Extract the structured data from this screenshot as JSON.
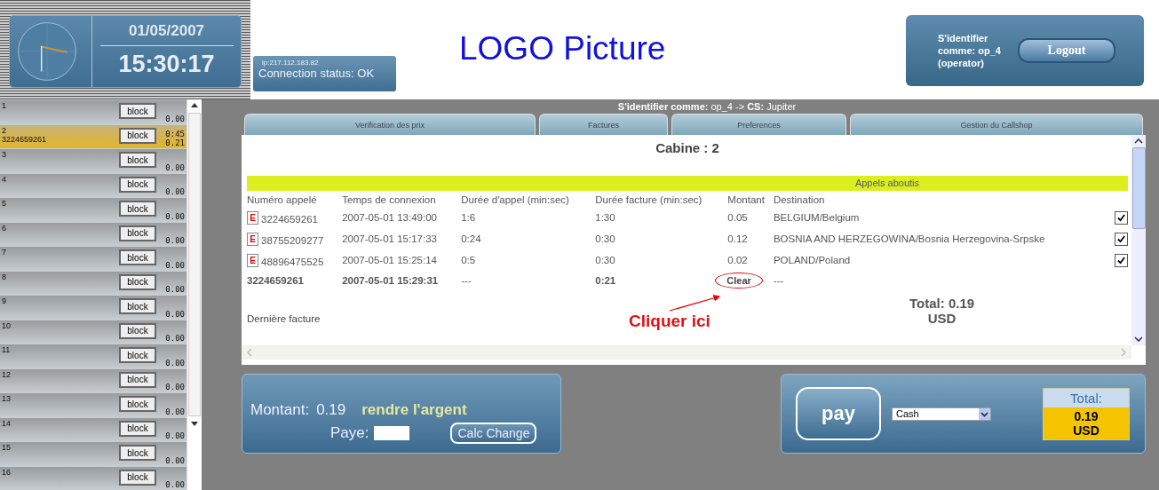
{
  "clock": {
    "date": "01/05/2007",
    "time": "15:30:17"
  },
  "connection": {
    "ip": "ip:217.112.183.82",
    "status": "Connection status: OK"
  },
  "logo": "LOGO Picture",
  "login": {
    "user": "S'identifier comme: op_4 (operator)",
    "button": "Logout"
  },
  "cabins": [
    {
      "number": "1",
      "amount": "0.00",
      "selected": false,
      "button": "block"
    },
    {
      "number": "2",
      "phone": "3224659261",
      "duration": "0:45",
      "amount": "0.21",
      "selected": true,
      "button": "block"
    },
    {
      "number": "3",
      "amount": "0.00",
      "selected": false,
      "button": "block"
    },
    {
      "number": "4",
      "amount": "0.00",
      "selected": false,
      "button": "block"
    },
    {
      "number": "5",
      "amount": "0.00",
      "selected": false,
      "button": "block"
    },
    {
      "number": "6",
      "amount": "0.00",
      "selected": false,
      "button": "block"
    },
    {
      "number": "7",
      "amount": "0.00",
      "selected": false,
      "button": "block"
    },
    {
      "number": "8",
      "amount": "0.00",
      "selected": false,
      "button": "block"
    },
    {
      "number": "9",
      "amount": "0.00",
      "selected": false,
      "button": "block"
    },
    {
      "number": "10",
      "amount": "0.00",
      "selected": false,
      "button": "block"
    },
    {
      "number": "11",
      "amount": "0.00",
      "selected": false,
      "button": "block"
    },
    {
      "number": "12",
      "amount": "0.00",
      "selected": false,
      "button": "block"
    },
    {
      "number": "13",
      "amount": "0.00",
      "selected": false,
      "button": "block"
    },
    {
      "number": "14",
      "amount": "0.00",
      "selected": false,
      "button": "block"
    },
    {
      "number": "15",
      "amount": "0.00",
      "selected": false,
      "button": "block"
    },
    {
      "number": "16",
      "amount": "0.00",
      "selected": false,
      "button": "block"
    }
  ],
  "session": "**S'identifier comme:** op_4 -> **CS:** Jupiter",
  "tabs": [
    "Verification des prix",
    "Factures",
    "Preferences",
    "Gestion du Callshop"
  ],
  "cabin_title": "Cabine : 2",
  "calls": {
    "title": "Appels aboutis",
    "columns": [
      "Numéro appelé",
      "Temps de connexion",
      "Durée d'appel (min:sec)",
      "Durée facture (min:sec)",
      "Montant",
      "Destination"
    ],
    "rows": [
      {
        "kind": "call",
        "badge": "E",
        "number": "3224659261",
        "connected": "2007-05-01 13:49:00",
        "call_duration": "1:6",
        "billed_duration": "1:30",
        "amount": "0.05",
        "destination": "BELGIUM/Belgium",
        "checked": true
      },
      {
        "kind": "call",
        "badge": "E",
        "number": "38755209277",
        "connected": "2007-05-01 15:17:33",
        "call_duration": "0:24",
        "billed_duration": "0:30",
        "amount": "0.12",
        "destination": "BOSNIA AND HERZEGOWINA/Bosnia Herzegovina-Srpske",
        "checked": true
      },
      {
        "kind": "call",
        "badge": "E",
        "number": "48896475525",
        "connected": "2007-05-01 15:25:14",
        "call_duration": "0:5",
        "billed_duration": "0:30",
        "amount": "0.02",
        "destination": "POLAND/Poland",
        "checked": true
      },
      {
        "kind": "current",
        "number": "3224659261",
        "connected": "2007-05-01 15:29:31",
        "call_duration": "---",
        "billed_duration": "0:21",
        "button": "Clear",
        "destination": "---"
      }
    ]
  },
  "last_invoice": "Dernière facture",
  "annotation": "Cliquer ici",
  "total": {
    "label": "Total: 0.19",
    "currency": "USD"
  },
  "change": {
    "amount_label": "Montant:",
    "amount": "0.19",
    "return_label": "rendre l'argent",
    "paid_label": "Paye:",
    "button": "Calc Change"
  },
  "payment": {
    "button": "pay",
    "method": "Cash",
    "total_label": "Total:",
    "total": "0.19",
    "currency": "USD"
  }
}
